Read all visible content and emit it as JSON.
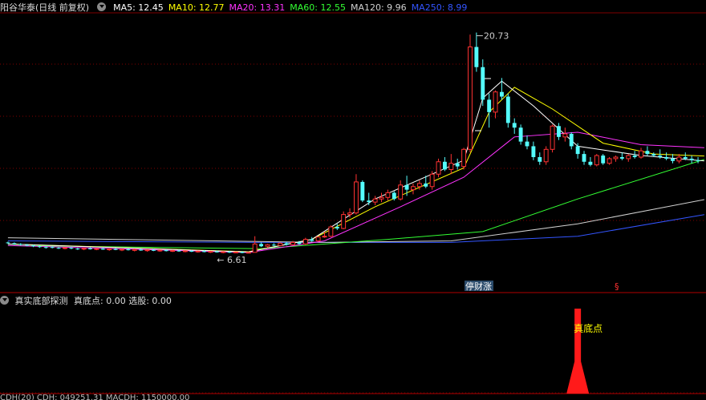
{
  "header": {
    "title": "阳谷华泰(日线 前复权)",
    "mas": [
      {
        "label": "MA5: 12.45",
        "color": "#ffffff"
      },
      {
        "label": "MA10: 12.77",
        "color": "#ffff00"
      },
      {
        "label": "MA20: 13.31",
        "color": "#ff33ff"
      },
      {
        "label": "MA60: 12.55",
        "color": "#33ff33"
      },
      {
        "label": "MA120: 9.96",
        "color": "#d0d0d0"
      },
      {
        "label": "MA250: 8.99",
        "color": "#3355ff"
      }
    ]
  },
  "indicator": {
    "name": "真实底部探测",
    "values": "真底点: 0.00  选股: 0.00",
    "signal_label": "真底点"
  },
  "markers": {
    "high_label": "20.73",
    "low_label": "6.61",
    "tag_label": "停财涨",
    "tag2_label": "§"
  },
  "footer": {
    "text": "CDH(20) CDH: 049251.31 MACDH: 1150000.00"
  },
  "chart_data": {
    "type": "candlestick",
    "ylim": [
      5.0,
      22.0
    ],
    "n": 110,
    "candles": [
      [
        7.2,
        7.25,
        7.1,
        7.15
      ],
      [
        7.15,
        7.2,
        7.05,
        7.1
      ],
      [
        7.1,
        7.15,
        7.0,
        7.05
      ],
      [
        7.05,
        7.1,
        6.95,
        7.0
      ],
      [
        7.0,
        7.05,
        6.9,
        6.95
      ],
      [
        6.95,
        7.0,
        6.85,
        6.9
      ],
      [
        6.9,
        6.95,
        6.8,
        6.88
      ],
      [
        6.9,
        6.95,
        6.82,
        6.85
      ],
      [
        6.85,
        6.9,
        6.78,
        6.82
      ],
      [
        6.82,
        6.9,
        6.75,
        6.86
      ],
      [
        6.85,
        6.9,
        6.76,
        6.8
      ],
      [
        6.8,
        6.85,
        6.72,
        6.78
      ],
      [
        6.78,
        6.85,
        6.7,
        6.82
      ],
      [
        6.82,
        6.88,
        6.74,
        6.76
      ],
      [
        6.76,
        6.82,
        6.7,
        6.8
      ],
      [
        6.8,
        6.86,
        6.72,
        6.74
      ],
      [
        6.74,
        6.8,
        6.66,
        6.78
      ],
      [
        6.78,
        6.84,
        6.7,
        6.72
      ],
      [
        6.72,
        6.78,
        6.64,
        6.76
      ],
      [
        6.76,
        6.82,
        6.68,
        6.7
      ],
      [
        6.7,
        6.78,
        6.62,
        6.74
      ],
      [
        6.74,
        6.8,
        6.66,
        6.68
      ],
      [
        6.68,
        6.76,
        6.6,
        6.72
      ],
      [
        6.72,
        6.78,
        6.64,
        6.66
      ],
      [
        6.66,
        6.74,
        6.6,
        6.7
      ],
      [
        6.7,
        6.76,
        6.62,
        6.64
      ],
      [
        6.64,
        6.72,
        6.58,
        6.68
      ],
      [
        6.68,
        6.74,
        6.6,
        6.62
      ],
      [
        6.62,
        6.7,
        6.56,
        6.66
      ],
      [
        6.66,
        6.72,
        6.58,
        6.6
      ],
      [
        6.6,
        6.68,
        6.54,
        6.64
      ],
      [
        6.64,
        6.7,
        6.56,
        6.58
      ],
      [
        6.58,
        6.66,
        6.52,
        6.62
      ],
      [
        6.62,
        6.68,
        6.54,
        6.56
      ],
      [
        6.56,
        6.64,
        6.5,
        6.6
      ],
      [
        6.6,
        6.66,
        6.52,
        6.54
      ],
      [
        6.54,
        6.62,
        6.5,
        6.58
      ],
      [
        6.58,
        6.64,
        6.5,
        6.52
      ],
      [
        6.52,
        6.6,
        6.61,
        6.56
      ],
      [
        6.56,
        7.6,
        6.61,
        7.1
      ],
      [
        7.1,
        7.2,
        6.9,
        6.95
      ],
      [
        6.95,
        7.1,
        6.85,
        7.05
      ],
      [
        7.05,
        7.15,
        6.95,
        7.0
      ],
      [
        7.0,
        7.2,
        6.95,
        7.15
      ],
      [
        7.15,
        7.25,
        7.0,
        7.05
      ],
      [
        7.05,
        7.3,
        7.0,
        7.2
      ],
      [
        7.2,
        7.3,
        7.05,
        7.1
      ],
      [
        7.1,
        7.5,
        7.05,
        7.4
      ],
      [
        7.4,
        7.55,
        7.25,
        7.3
      ],
      [
        7.3,
        7.6,
        7.25,
        7.55
      ],
      [
        7.55,
        7.9,
        7.5,
        7.6
      ],
      [
        7.6,
        8.3,
        7.55,
        8.2
      ],
      [
        8.2,
        8.4,
        8.0,
        8.1
      ],
      [
        8.1,
        9.2,
        8.05,
        9.0
      ],
      [
        9.0,
        9.4,
        8.8,
        9.1
      ],
      [
        9.1,
        11.6,
        9.0,
        11.1
      ],
      [
        11.1,
        11.2,
        9.8,
        9.9
      ],
      [
        9.9,
        10.4,
        9.6,
        9.8
      ],
      [
        9.8,
        10.2,
        9.6,
        10.0
      ],
      [
        10.0,
        10.4,
        9.8,
        10.1
      ],
      [
        10.1,
        10.6,
        9.9,
        10.4
      ],
      [
        10.4,
        10.5,
        9.9,
        10.0
      ],
      [
        10.0,
        11.2,
        9.9,
        10.9
      ],
      [
        10.9,
        11.5,
        10.2,
        10.6
      ],
      [
        10.6,
        11.0,
        10.3,
        10.8
      ],
      [
        10.8,
        11.2,
        10.6,
        11.0
      ],
      [
        11.0,
        11.5,
        10.7,
        10.8
      ],
      [
        10.8,
        11.8,
        10.6,
        11.6
      ],
      [
        11.6,
        12.6,
        11.4,
        12.4
      ],
      [
        12.4,
        12.7,
        11.8,
        11.9
      ],
      [
        11.9,
        12.9,
        11.6,
        12.3
      ],
      [
        12.3,
        12.6,
        11.9,
        12.1
      ],
      [
        12.1,
        13.3,
        11.9,
        13.2
      ],
      [
        13.2,
        20.6,
        13.0,
        19.8
      ],
      [
        19.8,
        20.73,
        18.2,
        18.5
      ],
      [
        18.5,
        19.0,
        16.0,
        16.4
      ],
      [
        16.4,
        16.8,
        14.6,
        15.6
      ],
      [
        15.6,
        17.0,
        15.2,
        16.9
      ],
      [
        16.9,
        17.8,
        16.4,
        16.6
      ],
      [
        16.6,
        16.8,
        14.6,
        14.9
      ],
      [
        14.9,
        15.2,
        14.2,
        14.6
      ],
      [
        14.6,
        14.8,
        13.5,
        13.7
      ],
      [
        13.7,
        14.1,
        13.2,
        13.4
      ],
      [
        13.4,
        13.7,
        12.5,
        12.7
      ],
      [
        12.7,
        13.0,
        12.2,
        12.4
      ],
      [
        12.4,
        13.4,
        12.2,
        13.2
      ],
      [
        13.2,
        14.8,
        13.0,
        14.7
      ],
      [
        14.7,
        14.9,
        13.8,
        14.0
      ],
      [
        14.0,
        14.6,
        13.7,
        14.2
      ],
      [
        14.2,
        14.3,
        13.2,
        13.4
      ],
      [
        13.4,
        13.6,
        12.6,
        12.9
      ],
      [
        12.9,
        13.1,
        12.2,
        12.4
      ],
      [
        12.4,
        12.7,
        12.1,
        12.2
      ],
      [
        12.2,
        12.9,
        12.1,
        12.8
      ],
      [
        12.8,
        12.9,
        12.2,
        12.3
      ],
      [
        12.3,
        12.7,
        12.2,
        12.6
      ],
      [
        12.6,
        12.8,
        12.4,
        12.7
      ],
      [
        12.7,
        13.0,
        12.5,
        12.6
      ],
      [
        12.6,
        12.9,
        12.4,
        12.8
      ],
      [
        12.8,
        13.1,
        12.6,
        12.7
      ],
      [
        12.7,
        13.3,
        12.6,
        13.1
      ],
      [
        13.1,
        13.4,
        12.8,
        12.9
      ],
      [
        12.9,
        13.0,
        12.7,
        12.8
      ],
      [
        12.8,
        13.2,
        12.6,
        12.7
      ],
      [
        12.7,
        13.0,
        12.5,
        12.6
      ],
      [
        12.6,
        12.9,
        12.3,
        12.45
      ],
      [
        12.45,
        12.9,
        12.3,
        12.7
      ],
      [
        12.7,
        13.0,
        12.5,
        12.6
      ],
      [
        12.6,
        12.8,
        12.3,
        12.5
      ],
      [
        12.5,
        12.7,
        12.3,
        12.45
      ]
    ],
    "ma_series": [
      {
        "name": "MA250",
        "color": "#3355ff",
        "points": [
          [
            0,
            7.3
          ],
          [
            40,
            7.2
          ],
          [
            70,
            7.2
          ],
          [
            90,
            7.6
          ],
          [
            110,
            8.99
          ]
        ]
      },
      {
        "name": "MA120",
        "color": "#d0d0d0",
        "points": [
          [
            0,
            7.5
          ],
          [
            50,
            7.2
          ],
          [
            70,
            7.3
          ],
          [
            90,
            8.4
          ],
          [
            110,
            9.96
          ]
        ]
      },
      {
        "name": "MA60",
        "color": "#33ff33",
        "points": [
          [
            0,
            7.0
          ],
          [
            40,
            6.8
          ],
          [
            60,
            7.4
          ],
          [
            75,
            7.9
          ],
          [
            90,
            10.0
          ],
          [
            110,
            12.55
          ]
        ]
      },
      {
        "name": "MA20",
        "color": "#ff33ff",
        "points": [
          [
            0,
            7.0
          ],
          [
            38,
            6.55
          ],
          [
            50,
            7.3
          ],
          [
            62,
            9.5
          ],
          [
            72,
            11.4
          ],
          [
            80,
            14.0
          ],
          [
            90,
            14.3
          ],
          [
            100,
            13.5
          ],
          [
            110,
            13.31
          ]
        ]
      },
      {
        "name": "MA10",
        "color": "#ffff00",
        "points": [
          [
            0,
            7.1
          ],
          [
            38,
            6.6
          ],
          [
            48,
            7.4
          ],
          [
            58,
            9.5
          ],
          [
            72,
            12.0
          ],
          [
            76,
            15.6
          ],
          [
            80,
            17.2
          ],
          [
            86,
            15.8
          ],
          [
            94,
            13.6
          ],
          [
            102,
            12.9
          ],
          [
            110,
            12.77
          ]
        ]
      },
      {
        "name": "MA5",
        "color": "#ffffff",
        "points": [
          [
            0,
            7.1
          ],
          [
            38,
            6.58
          ],
          [
            48,
            7.4
          ],
          [
            58,
            10.0
          ],
          [
            72,
            12.5
          ],
          [
            75,
            16.5
          ],
          [
            78,
            17.6
          ],
          [
            83,
            16.0
          ],
          [
            90,
            13.4
          ],
          [
            100,
            12.8
          ],
          [
            110,
            12.45
          ]
        ]
      }
    ],
    "signal": {
      "bar": 90,
      "value": 1
    }
  }
}
